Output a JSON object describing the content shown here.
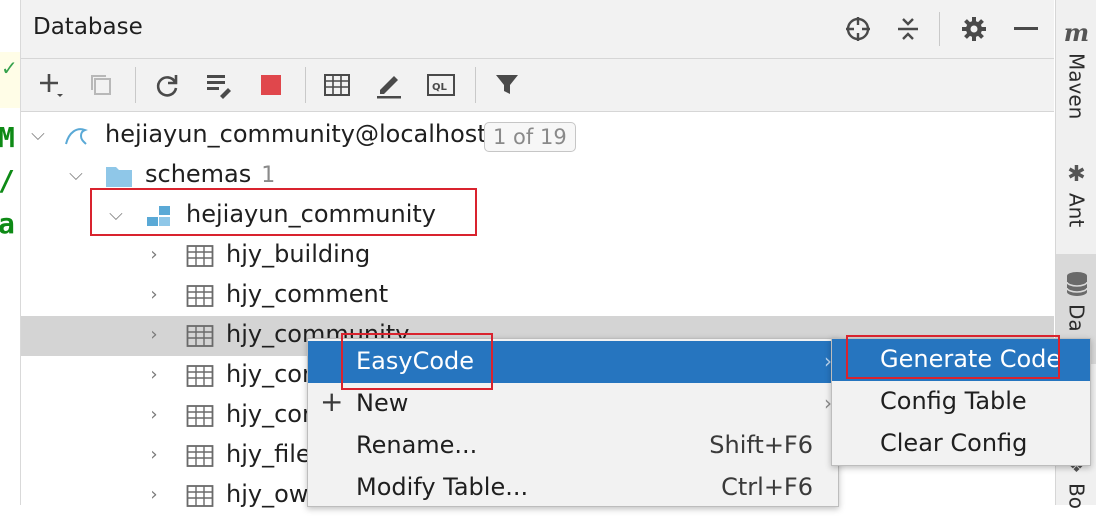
{
  "panel": {
    "title": "Database"
  },
  "header_icons": [
    "crosshair-icon",
    "collapse-all-icon",
    "gear-icon",
    "minimize-icon"
  ],
  "toolbar_icons": [
    "add-icon",
    "duplicate-icon",
    "refresh-icon",
    "schema-settings-icon",
    "stop-icon",
    "table-view-icon",
    "edit-icon",
    "sql-console-icon",
    "filter-icon"
  ],
  "tree": {
    "connection": {
      "label": "hejiayun_community@localhost",
      "badge": "1 of 19"
    },
    "schemas": {
      "label": "schemas",
      "count": "1"
    },
    "schema": {
      "label": "hejiayun_community"
    },
    "tables": [
      {
        "label": "hjy_building"
      },
      {
        "label": "hjy_comment"
      },
      {
        "label": "hjy_community"
      },
      {
        "label": "hjy_con"
      },
      {
        "label": "hjy_con"
      },
      {
        "label": "hjy_file"
      },
      {
        "label": "hjy_ow"
      }
    ]
  },
  "context_menu": {
    "items": [
      {
        "label": "EasyCode",
        "shortcut": "",
        "submenu": true
      },
      {
        "label": "New",
        "shortcut": "",
        "submenu": true
      },
      {
        "label": "Rename...",
        "shortcut": "Shift+F6",
        "submenu": false
      },
      {
        "label": "Modify Table...",
        "shortcut": "Ctrl+F6",
        "submenu": false
      }
    ]
  },
  "submenu": {
    "items": [
      {
        "label": "Generate Code"
      },
      {
        "label": "Config Table"
      },
      {
        "label": "Clear Config"
      }
    ]
  },
  "side_tabs": [
    {
      "label": "Maven"
    },
    {
      "label": "Ant"
    },
    {
      "label": "Da"
    },
    {
      "label": "Bo"
    }
  ],
  "editor_fragment": {
    "chars": [
      "M",
      "/",
      "a"
    ]
  },
  "colors": {
    "accent": "#2675bf",
    "selection": "#d4d4d4",
    "highlight": "#d9232e",
    "folder": "#8fc7e8",
    "stop": "#e0474c"
  }
}
